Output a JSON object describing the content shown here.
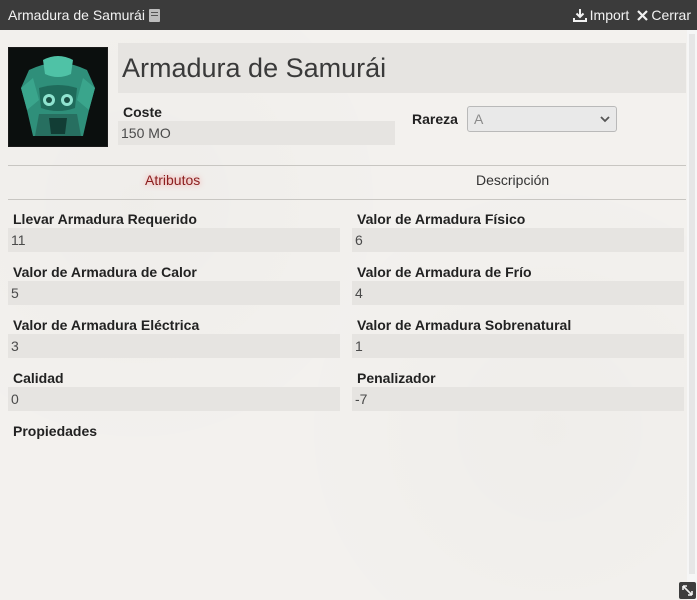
{
  "window": {
    "title": "Armadura de Samurái",
    "import_label": "Import",
    "close_label": "Cerrar"
  },
  "item": {
    "name": "Armadura de Samurái",
    "cost_label": "Coste",
    "cost_value": "150 MO",
    "rarity_label": "Rareza",
    "rarity_value": "A"
  },
  "tabs": [
    {
      "label": "Atributos",
      "active": true
    },
    {
      "label": "Descripción",
      "active": false
    }
  ],
  "attributes": {
    "left": [
      {
        "label": "Llevar Armadura Requerido",
        "value": "11"
      },
      {
        "label": "Valor de Armadura de Calor",
        "value": "5"
      },
      {
        "label": "Valor de Armadura Eléctrica",
        "value": "3"
      },
      {
        "label": "Calidad",
        "value": "0"
      }
    ],
    "right": [
      {
        "label": "Valor de Armadura Físico",
        "value": "6"
      },
      {
        "label": "Valor de Armadura de Frío",
        "value": "4"
      },
      {
        "label": "Valor de Armadura Sobrenatural",
        "value": "1"
      },
      {
        "label": "Penalizador",
        "value": "-7"
      }
    ],
    "properties_label": "Propiedades"
  },
  "icons": [
    "book-icon",
    "download-icon",
    "close-icon",
    "chevron-down-icon",
    "resize-icon"
  ]
}
